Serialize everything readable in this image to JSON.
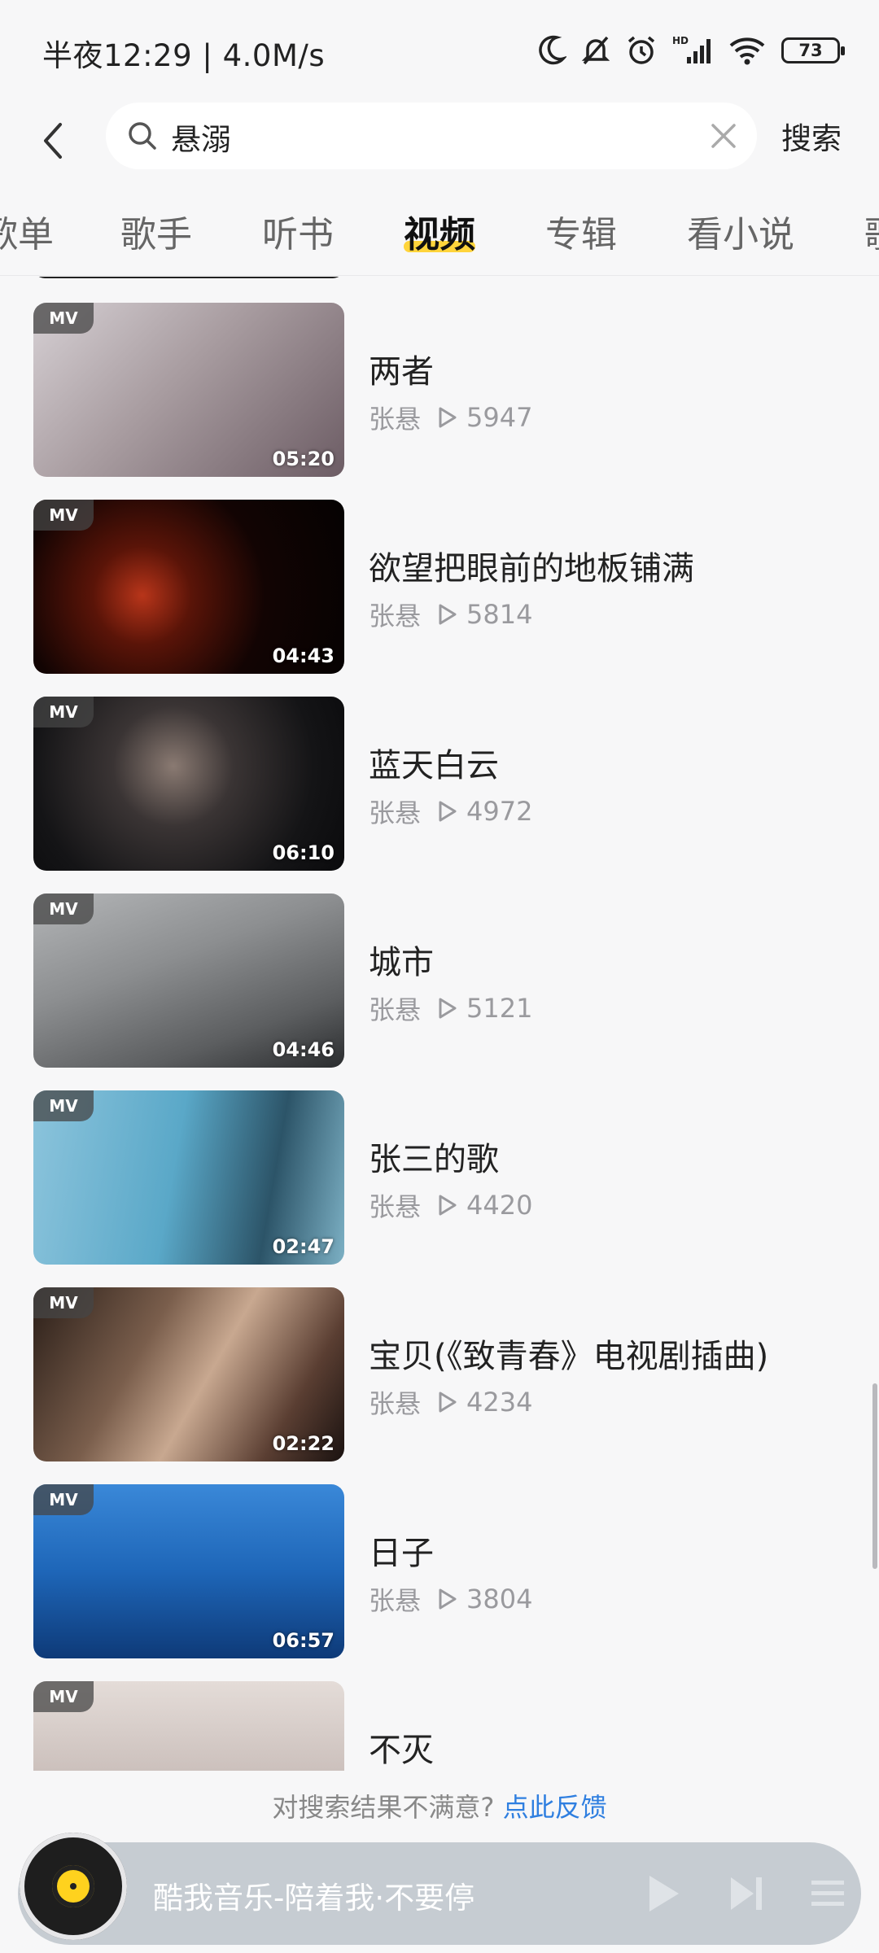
{
  "status_bar": {
    "time_text": "半夜12:29 | 4.0M/s",
    "battery": "73",
    "icons": [
      "moon-icon",
      "mute-icon",
      "alarm-icon",
      "signal-icon",
      "wifi-icon",
      "battery-icon"
    ]
  },
  "search": {
    "query": "悬溺",
    "button_label": "搜索"
  },
  "tabs": [
    {
      "label": "歌单"
    },
    {
      "label": "歌手"
    },
    {
      "label": "听书"
    },
    {
      "label": "视频",
      "active": true
    },
    {
      "label": "专辑"
    },
    {
      "label": "看小说"
    },
    {
      "label": "歌"
    }
  ],
  "videos": [
    {
      "badge": "MV",
      "title": "两者",
      "artist": "张悬",
      "plays": "5947",
      "duration": "05:20",
      "thumb_color": "#c8c2c4"
    },
    {
      "badge": "MV",
      "title": "欲望把眼前的地板铺满",
      "artist": "张悬",
      "plays": "5814",
      "duration": "04:43",
      "thumb_color": "#1a0805"
    },
    {
      "badge": "MV",
      "title": "蓝天白云",
      "artist": "张悬",
      "plays": "4972",
      "duration": "06:10",
      "thumb_color": "#1b1b1d"
    },
    {
      "badge": "MV",
      "title": "城市",
      "artist": "张悬",
      "plays": "5121",
      "duration": "04:46",
      "thumb_color": "#8a8c8e"
    },
    {
      "badge": "MV",
      "title": "张三的歌",
      "artist": "张悬",
      "plays": "4420",
      "duration": "02:47",
      "thumb_color": "#5aa8c8"
    },
    {
      "badge": "MV",
      "title": "宝贝(《致青春》电视剧插曲)",
      "artist": "张悬",
      "plays": "4234",
      "duration": "02:22",
      "thumb_color": "#3a2a22"
    },
    {
      "badge": "MV",
      "title": "日子",
      "artist": "张悬",
      "plays": "3804",
      "duration": "06:57",
      "thumb_color": "#1e66b8"
    },
    {
      "badge": "MV",
      "title": "不灭",
      "artist": "",
      "plays": "",
      "duration": "",
      "thumb_color": "#d8d0cc"
    }
  ],
  "feedback": {
    "text": "对搜索结果不满意?",
    "link": "点此反馈"
  },
  "player": {
    "now_playing": "酷我音乐-陪着我·不要停"
  },
  "colors": {
    "accent_yellow": "#ffd43b",
    "link_blue": "#2f7fe0",
    "background": "#f7f7f8"
  }
}
